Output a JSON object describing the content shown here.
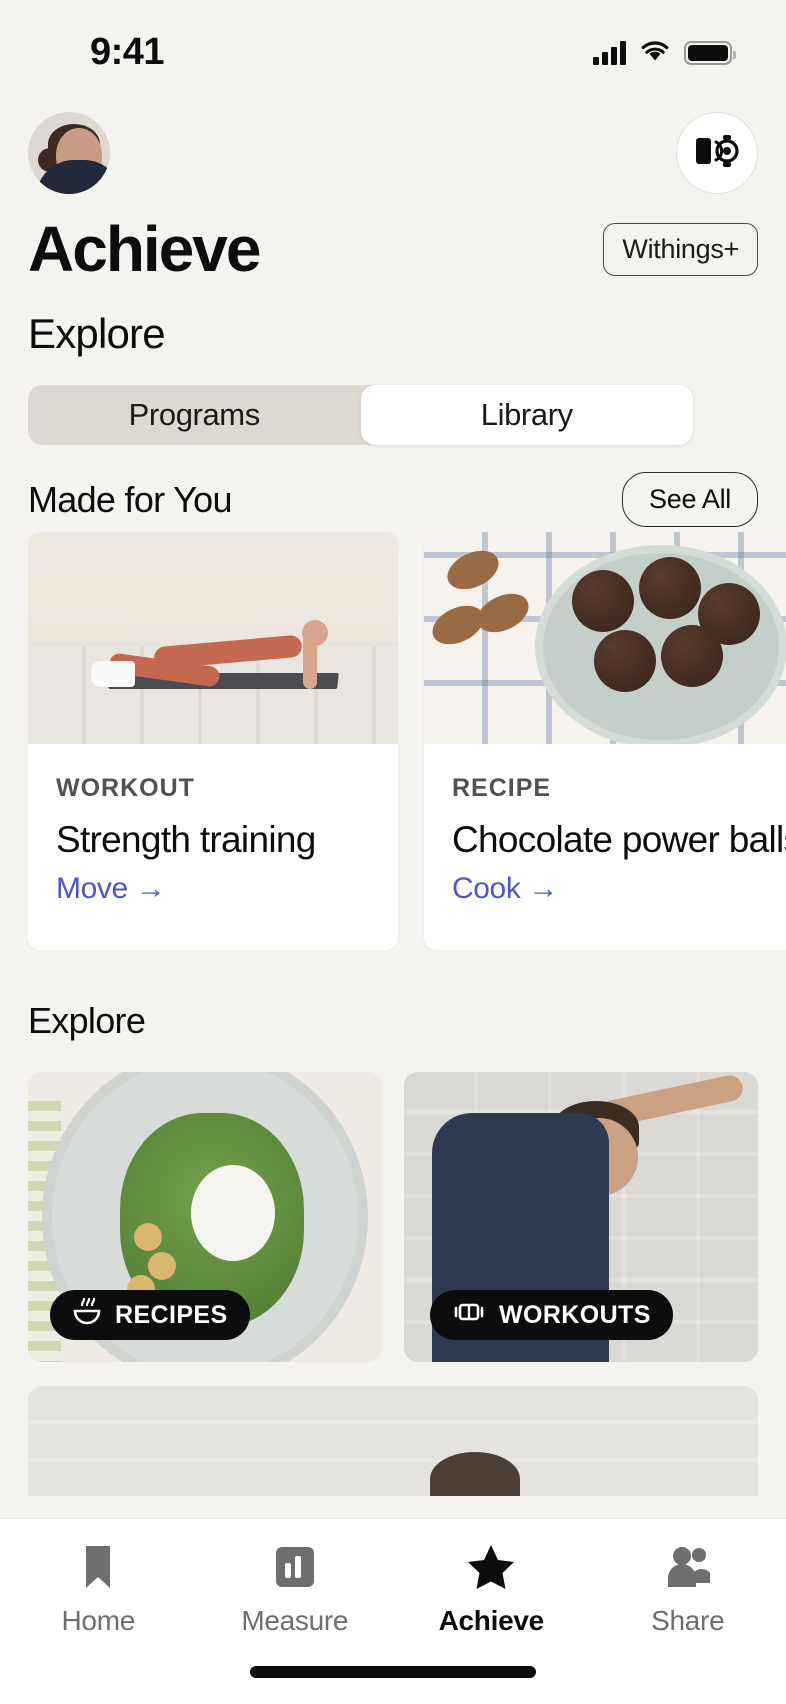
{
  "status_bar": {
    "time": "9:41",
    "signal_icon": "cellular-signal-icon",
    "wifi_icon": "wifi-icon",
    "battery_icon": "battery-icon"
  },
  "header": {
    "avatar_name": "profile-avatar",
    "device_button_icon": "watch-device-icon",
    "title": "Achieve",
    "plus_badge": "Withings+",
    "subtitle": "Explore"
  },
  "segmented_control": {
    "options": [
      {
        "label": "Programs",
        "selected": false
      },
      {
        "label": "Library",
        "selected": true
      }
    ]
  },
  "made_for_you": {
    "title": "Made for You",
    "see_all_label": "See All",
    "cards": [
      {
        "kicker": "WORKOUT",
        "name": "Strength training",
        "link": "Move →",
        "image": "woman-plank-exercise-photo"
      },
      {
        "kicker": "RECIPE",
        "name": "Chocolate power balls",
        "link": "Cook →",
        "image": "chocolate-power-balls-photo"
      }
    ]
  },
  "explore": {
    "title": "Explore",
    "categories": [
      {
        "badge": "RECIPES",
        "icon": "bowl-steam-icon",
        "image": "salad-bowl-photo"
      },
      {
        "badge": "WORKOUTS",
        "icon": "dumbbell-icon",
        "image": "man-side-stretch-photo"
      }
    ]
  },
  "tab_bar": {
    "tabs": [
      {
        "label": "Home",
        "icon": "bookmark-icon",
        "active": false
      },
      {
        "label": "Measure",
        "icon": "bar-chart-icon",
        "active": false
      },
      {
        "label": "Achieve",
        "icon": "star-icon",
        "active": true
      },
      {
        "label": "Share",
        "icon": "people-icon",
        "active": false
      }
    ]
  },
  "colors": {
    "background": "#f4f3f0",
    "accent_link": "#4b57c7",
    "badge_bg": "#0d0d0d",
    "segment_track": "#ddd9d1",
    "text_primary": "#0d0d0d"
  }
}
